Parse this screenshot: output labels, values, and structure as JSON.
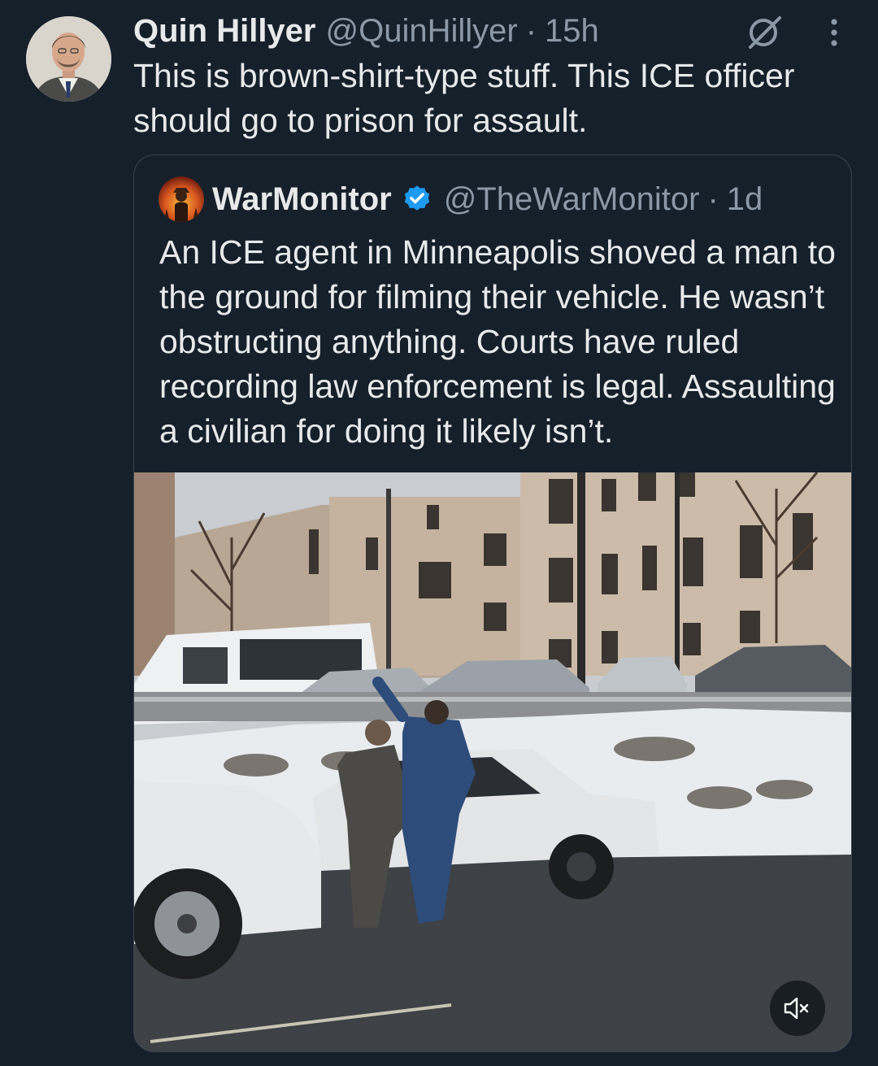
{
  "tweet": {
    "author_name": "Quin Hillyer",
    "handle": "@QuinHillyer",
    "separator": "·",
    "time": "15h",
    "text": "This is brown-shirt-type stuff. This ICE officer should go to prison for assault.",
    "avatar_icon": "profile-photo",
    "grok_icon": "grok-icon",
    "more_icon": "more-vertical-icon"
  },
  "quoted": {
    "author_name": "WarMonitor",
    "handle": "@TheWarMonitor",
    "separator": "·",
    "time": "1d",
    "verified": true,
    "verified_color": "#1d9bf0",
    "text": "An ICE agent in Minneapolis shoved a man to the ground for filming their vehicle. He wasn’t obstructing anything. Courts have ruled recording law enforcement is legal. Assaulting a civilian for doing it likely isn’t.",
    "media": {
      "type": "video",
      "muted": true,
      "mute_icon": "speaker-muted-icon"
    }
  },
  "colors": {
    "background": "#15202b",
    "text_primary": "#e7e9ea",
    "text_secondary": "#8b98a5",
    "border": "#38444d"
  }
}
